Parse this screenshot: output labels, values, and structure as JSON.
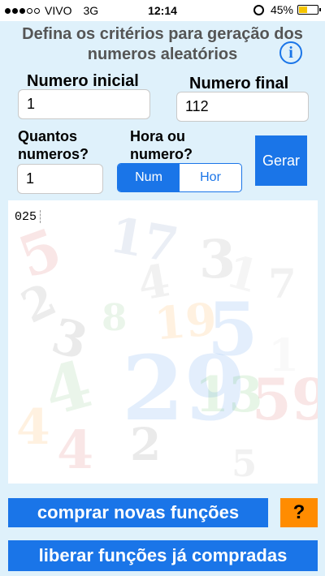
{
  "status_bar": {
    "carrier": "VIVO",
    "network": "3G",
    "time": "12:14",
    "battery_percent": "45%",
    "battery_level": 0.45
  },
  "header": {
    "title": "Defina os critérios para geração dos numeros aleatórios",
    "info_icon": "i"
  },
  "form": {
    "start_label": "Numero inicial",
    "start_value": "1",
    "end_label": "Numero final",
    "end_value": "112",
    "quantity_label": "Quantos numeros?",
    "quantity_value": "1",
    "mode_label": "Hora ou numero?",
    "mode_options": [
      "Num",
      "Hor"
    ],
    "mode_selected": "Num",
    "generate_label": "Gerar"
  },
  "output": {
    "result": "025"
  },
  "footer": {
    "buy_label": "comprar novas funções",
    "help_label": "?",
    "unlock_label": "liberar funções já compradas"
  },
  "colors": {
    "accent": "#1a75e8",
    "background": "#dff1fb",
    "help": "#ff8c00"
  }
}
